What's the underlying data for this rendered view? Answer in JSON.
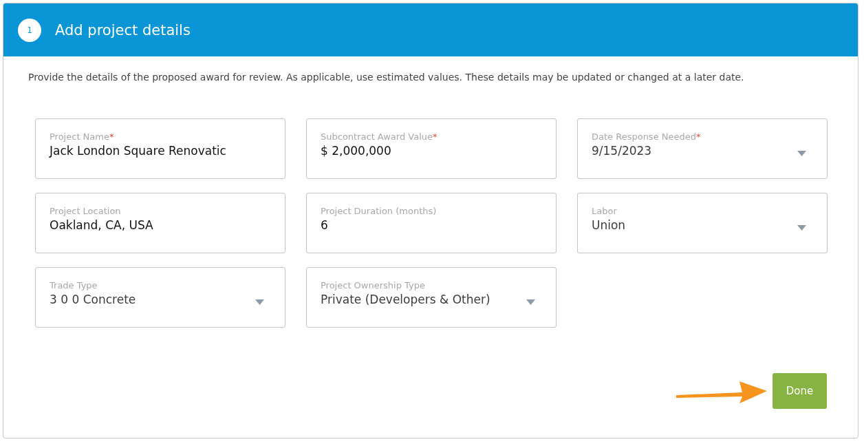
{
  "header": {
    "step": "1",
    "title": "Add project details"
  },
  "intro": "Provide the details of the proposed award for review. As applicable, use estimated values. These details may be updated or changed at a later date.",
  "fields": [
    {
      "kind": "text",
      "label": "Project Name",
      "required_mark": "*",
      "value": "Jack London Square Renovatic"
    },
    {
      "kind": "text",
      "label": "Subcontract Award Value",
      "required_mark": "*",
      "value": "$ 2,000,000"
    },
    {
      "kind": "select",
      "label": "Date Response Needed",
      "required_mark": "*",
      "value": "9/15/2023"
    },
    {
      "kind": "text",
      "label": "Project Location",
      "value": "Oakland, CA, USA"
    },
    {
      "kind": "text",
      "label": "Project Duration (months)",
      "value": "6"
    },
    {
      "kind": "select",
      "label": "Labor",
      "value": "Union"
    },
    {
      "kind": "select",
      "label": "Trade Type",
      "value": "3 0 0 Concrete"
    },
    {
      "kind": "select",
      "label": "Project Ownership Type",
      "value": "Private (Developers & Other)"
    }
  ],
  "done_button": "Done"
}
